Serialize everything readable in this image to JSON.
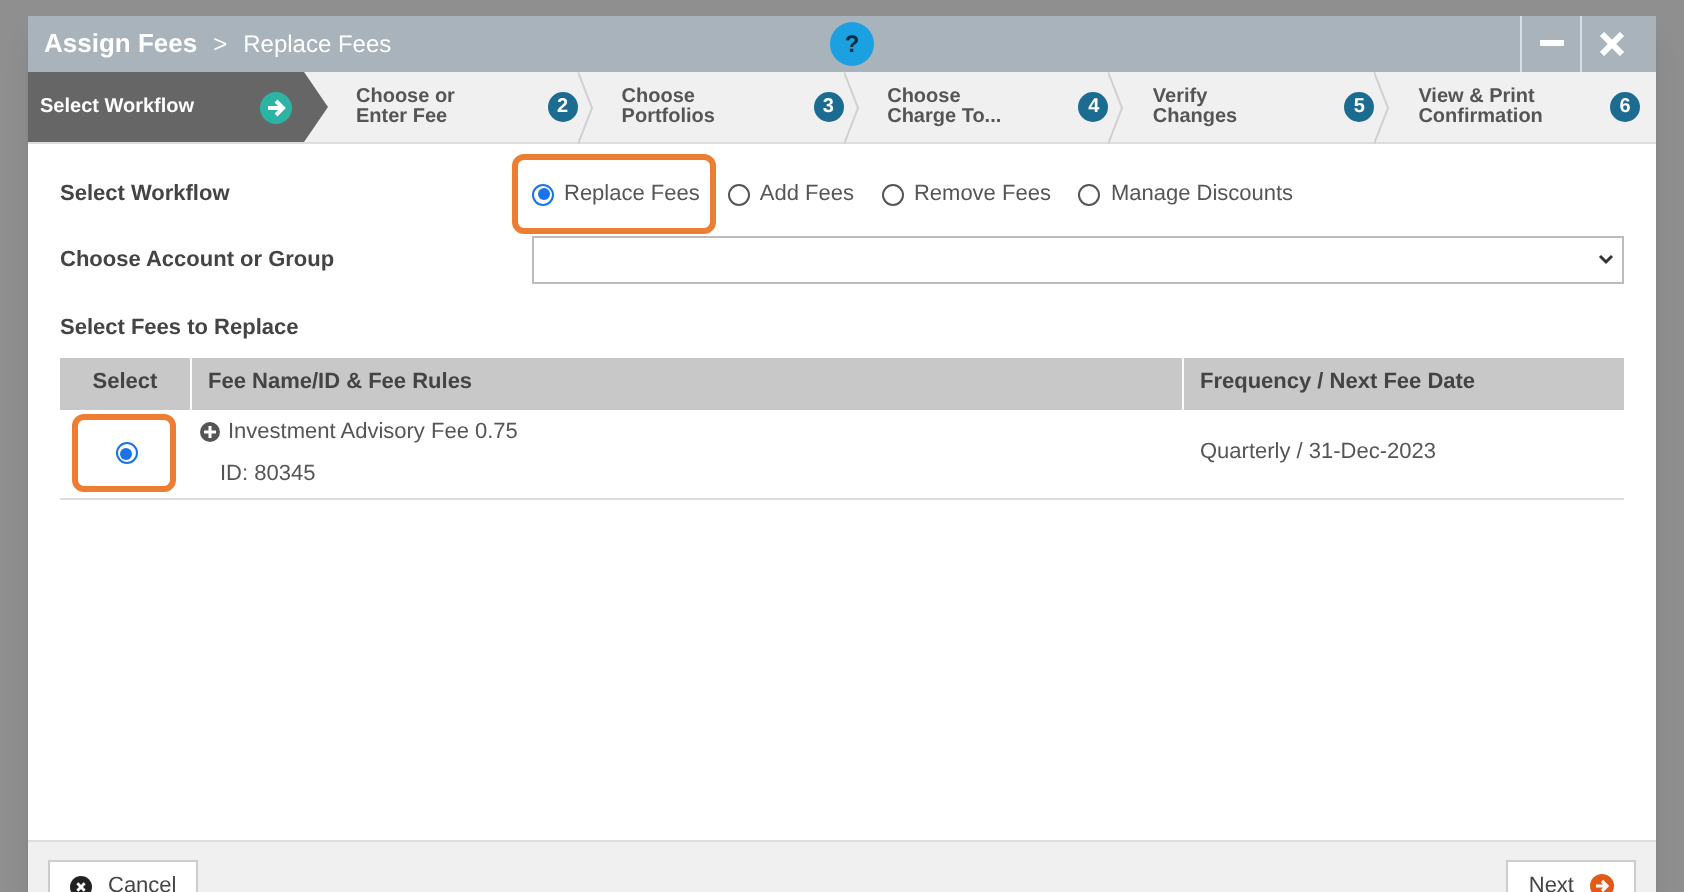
{
  "window": {
    "title": "Assign Fees",
    "breadcrumb_separator": ">",
    "subtitle": "Replace Fees",
    "help": "?"
  },
  "steps": [
    {
      "label": "Select Workflow",
      "selected": true
    },
    {
      "label": "Choose or\nEnter Fee",
      "number": "2",
      "selected": false
    },
    {
      "label": "Choose\nPortfolios",
      "number": "3",
      "selected": false
    },
    {
      "label": "Choose\nCharge To...",
      "number": "4",
      "selected": false
    },
    {
      "label": "Verify\nChanges",
      "number": "5",
      "selected": false
    },
    {
      "label": "View & Print\nConfirmation",
      "number": "6",
      "selected": false
    }
  ],
  "workflow": {
    "label": "Select Workflow",
    "options": [
      {
        "label": "Replace Fees",
        "selected": true,
        "highlighted": true
      },
      {
        "label": "Add Fees",
        "selected": false,
        "highlighted": false
      },
      {
        "label": "Remove Fees",
        "selected": false,
        "highlighted": false
      },
      {
        "label": "Manage Discounts",
        "selected": false,
        "highlighted": false
      }
    ]
  },
  "account": {
    "label": "Choose Account or Group"
  },
  "fees": {
    "label": "Select Fees to Replace",
    "columns": [
      "Select",
      "Fee Name/ID & Fee Rules",
      "Frequency / Next Fee Date"
    ],
    "rows": [
      {
        "selected": true,
        "highlighted": true,
        "name": "Investment Advisory Fee 0.75",
        "id": "ID: 80345",
        "frequency": "Quarterly / 31-Dec-2023"
      }
    ]
  },
  "footer": {
    "cancel": "Cancel",
    "next": "Next"
  }
}
